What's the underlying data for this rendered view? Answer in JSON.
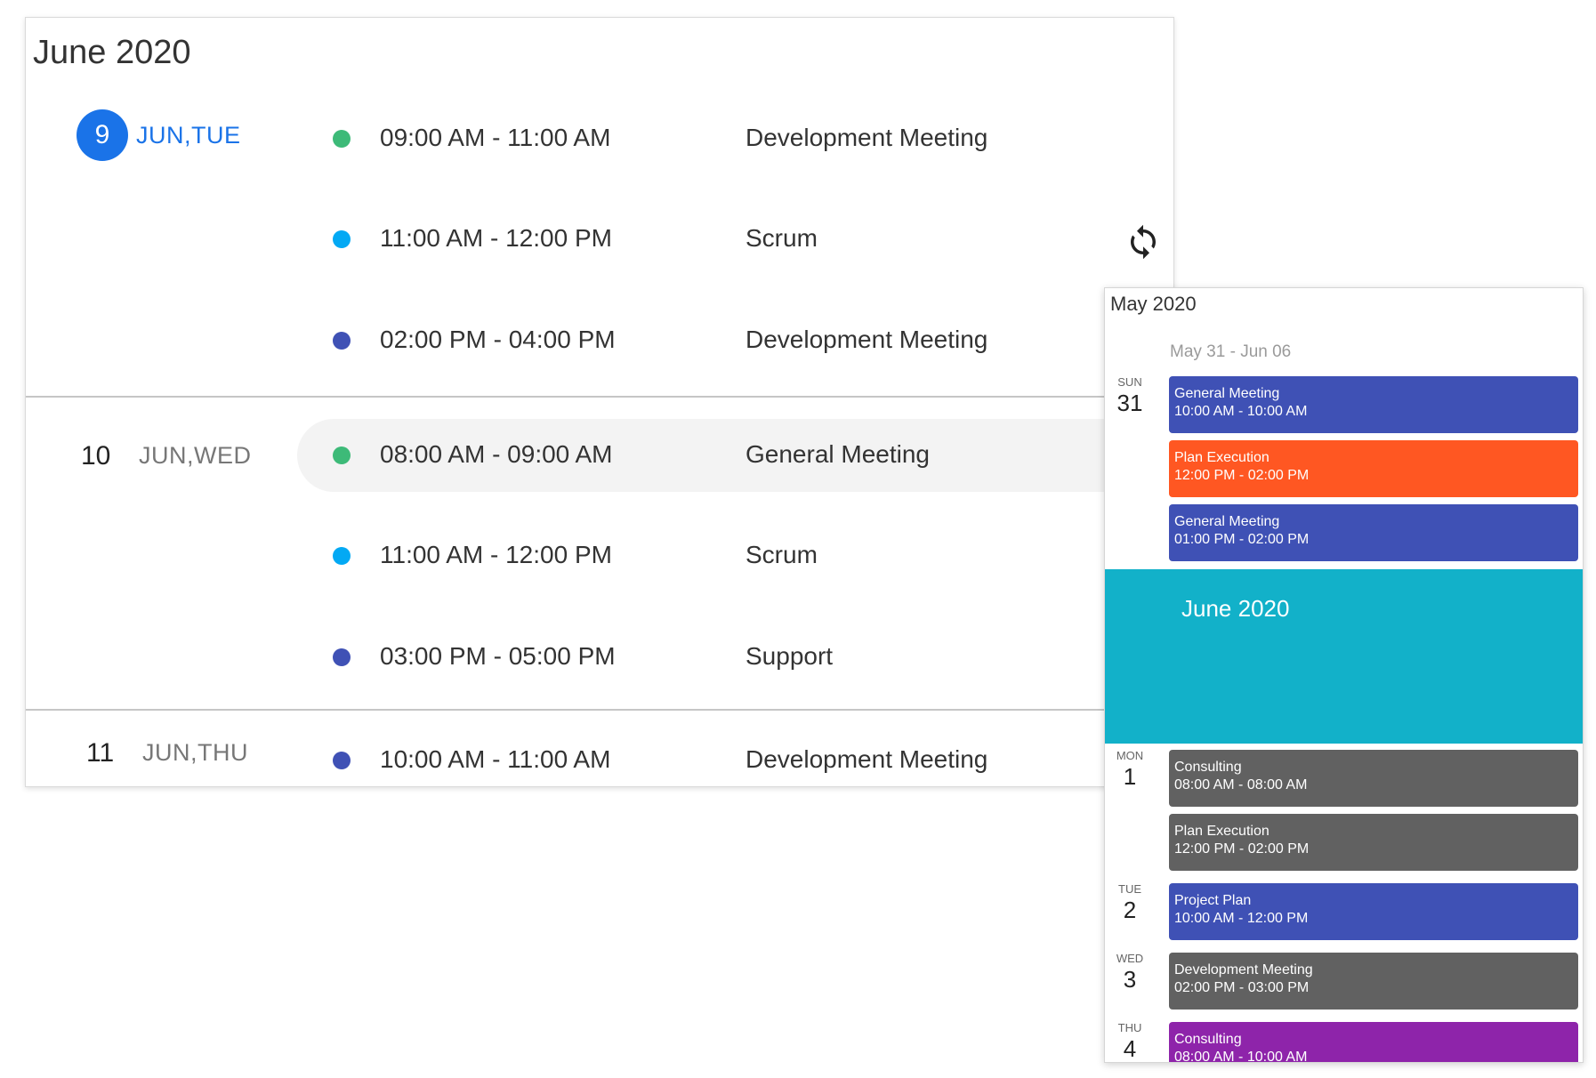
{
  "agenda": {
    "title": "June 2020",
    "days": [
      {
        "num": "9",
        "label": "JUN,TUE",
        "active": true,
        "events": [
          {
            "time": "09:00 AM - 11:00 AM",
            "title": "Development Meeting",
            "color": "#3dba78"
          },
          {
            "time": "11:00 AM - 12:00 PM",
            "title": "Scrum",
            "color": "#03a9f4"
          },
          {
            "time": "02:00 PM - 04:00 PM",
            "title": "Development Meeting",
            "color": "#3f51b5"
          }
        ]
      },
      {
        "num": "10",
        "label": "JUN,WED",
        "active": false,
        "events": [
          {
            "time": "08:00 AM - 09:00 AM",
            "title": "General Meeting",
            "color": "#3dba78",
            "hover": true
          },
          {
            "time": "11:00 AM - 12:00 PM",
            "title": "Scrum",
            "color": "#03a9f4"
          },
          {
            "time": "03:00 PM - 05:00 PM",
            "title": "Support",
            "color": "#3f51b5"
          }
        ]
      },
      {
        "num": "11",
        "label": "JUN,THU",
        "active": false,
        "events": [
          {
            "time": "10:00 AM - 11:00 AM",
            "title": "Development Meeting",
            "color": "#3f51b5"
          }
        ]
      }
    ],
    "sync_icon": "sync-icon"
  },
  "panel": {
    "title": "May 2020",
    "week_label": "May 31 - Jun 06",
    "banner": "June 2020",
    "days": [
      {
        "dow": "SUN",
        "num": "31"
      },
      {
        "dow": "MON",
        "num": "1"
      },
      {
        "dow": "TUE",
        "num": "2"
      },
      {
        "dow": "WED",
        "num": "3"
      },
      {
        "dow": "THU",
        "num": "4"
      }
    ],
    "appointments": [
      {
        "title": "General Meeting",
        "time": "10:00 AM - 10:00 AM",
        "color": "#3f51b5"
      },
      {
        "title": "Plan Execution",
        "time": "12:00 PM - 02:00 PM",
        "color": "#ff5722"
      },
      {
        "title": "General Meeting",
        "time": "01:00 PM - 02:00 PM",
        "color": "#3f51b5"
      },
      {
        "title": "Consulting",
        "time": "08:00 AM - 08:00 AM",
        "color": "#616161"
      },
      {
        "title": "Plan Execution",
        "time": "12:00 PM - 02:00 PM",
        "color": "#616161"
      },
      {
        "title": "Project Plan",
        "time": "10:00 AM - 12:00 PM",
        "color": "#3f51b5"
      },
      {
        "title": "Development Meeting",
        "time": "02:00 PM - 03:00 PM",
        "color": "#616161"
      },
      {
        "title": "Consulting",
        "time": "08:00 AM - 10:00 AM",
        "color": "#8e24aa"
      }
    ]
  }
}
